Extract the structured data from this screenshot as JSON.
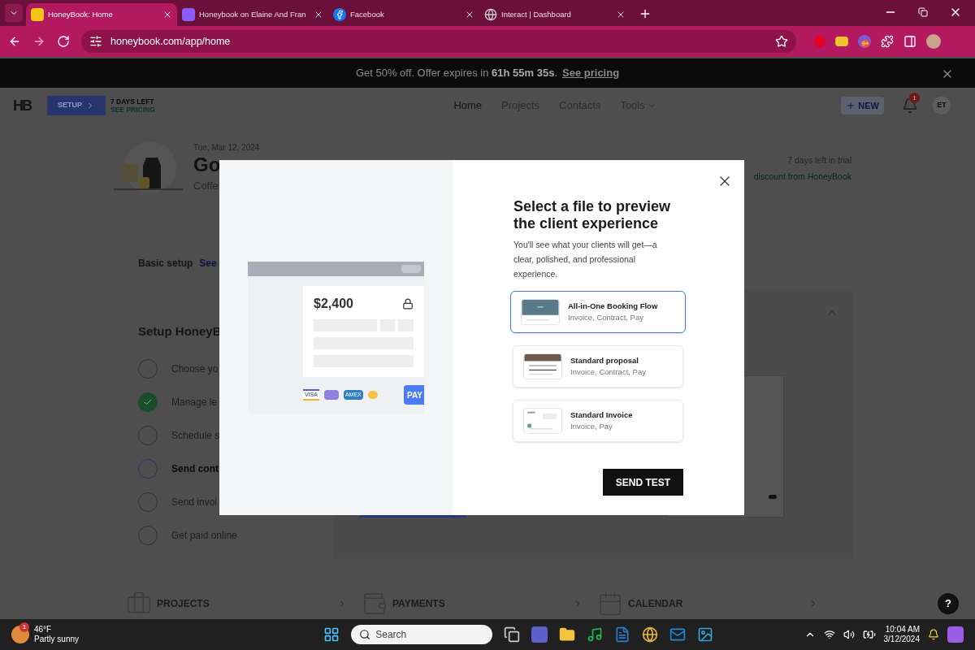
{
  "browser": {
    "tabs": [
      {
        "title": "HoneyBook: Home",
        "selected": true,
        "kind": "hb"
      },
      {
        "title": "Honeybook on Elaine And Fran",
        "selected": false,
        "kind": "board"
      },
      {
        "title": "Facebook",
        "selected": false,
        "kind": "facebook"
      },
      {
        "title": "Interact | Dashboard",
        "selected": false,
        "kind": "globe"
      }
    ],
    "url": "honeybook.com/app/home",
    "extension_badge": "9+"
  },
  "promo": {
    "text": "Get 50% off. Offer expires in **61h 55m 35s**.",
    "link": "See pricing"
  },
  "nav": {
    "logo": "HB",
    "setup_button": "SETUP",
    "trial": "7 DAYS LEFT",
    "pricing": "SEE PRICING",
    "links": [
      {
        "label": "Home",
        "selected": true
      },
      {
        "label": "Projects",
        "selected": false
      },
      {
        "label": "Contacts",
        "selected": false
      },
      {
        "label": "Tools",
        "selected": false,
        "dropdown": true
      }
    ],
    "new_button": "NEW",
    "notifications": "1",
    "avatar": "ET"
  },
  "header": {
    "date": "Tue, Mar 12, 2024",
    "greeting": "Go",
    "subtitle": "Coffe",
    "trial_note": "7 days left in trial",
    "discount": "discount from HoneyBook"
  },
  "basic_setup": {
    "label": "Basic setup",
    "link": "See"
  },
  "setup": {
    "title": "Setup HoneyB",
    "steps": [
      {
        "label": "Choose yo",
        "checked": false,
        "selected": false
      },
      {
        "label": "Manage le",
        "checked": true,
        "selected": false
      },
      {
        "label": "Schedule s",
        "checked": false,
        "selected": false
      },
      {
        "label": "Send cont",
        "checked": false,
        "selected": true
      },
      {
        "label": "Send invoi",
        "checked": false,
        "selected": false
      },
      {
        "label": "Get paid online",
        "checked": false,
        "selected": false
      }
    ]
  },
  "tiles": [
    {
      "label": "PROJECTS",
      "kind": "briefcase"
    },
    {
      "label": "PAYMENTS",
      "kind": "wallet"
    },
    {
      "label": "CALENDAR",
      "kind": "calendar"
    }
  ],
  "help": "?",
  "modal": {
    "preview": {
      "amount": "$2,400",
      "cards": [
        "VISA",
        "AMEX"
      ],
      "pay": "PAY"
    },
    "title": "Select a file to preview the client experience",
    "description": "You'll see what your clients will get—a clear, polished, and professional experience.",
    "files": [
      {
        "name": "All-in-One Booking Flow",
        "parts": "Invoice, Contract, Pay",
        "selected": true,
        "kind": "flow"
      },
      {
        "name": "Standard proposal",
        "parts": "Invoice, Contract, Pay",
        "selected": false,
        "kind": "proposal"
      },
      {
        "name": "Standard Invoice",
        "parts": "Invoice, Pay",
        "selected": false,
        "kind": "invoice"
      }
    ],
    "send_button": "SEND TEST"
  },
  "taskbar": {
    "temperature": "46°F",
    "weather": "Partly sunny",
    "weather_badge": "1",
    "search_placeholder": "Search",
    "time": "10:04 AM",
    "date": "3/12/2024"
  }
}
